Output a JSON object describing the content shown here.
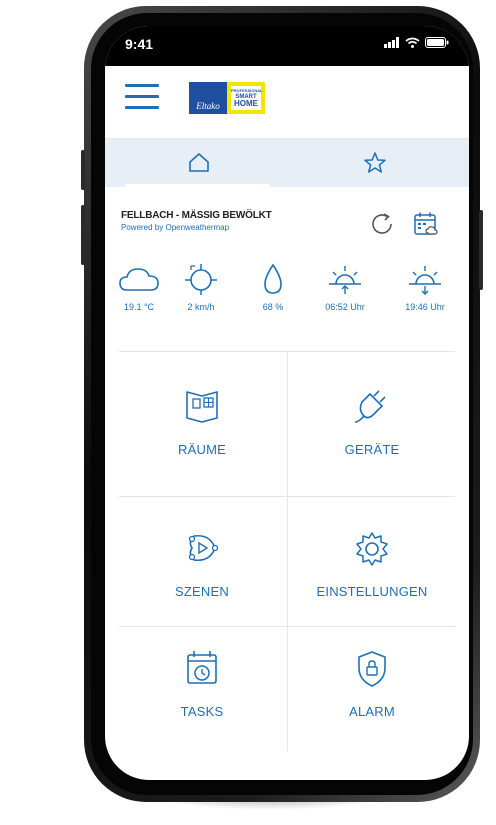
{
  "status_bar": {
    "time": "9:41"
  },
  "header": {
    "logo_text": "Eltako",
    "badge_lines": [
      "PROFESSIONAL",
      "SMART",
      "HOME"
    ]
  },
  "weather": {
    "title": "FELLBACH - MÄSSIG BEWÖLKT",
    "subtitle": "Powered by Openweathermap",
    "items": [
      {
        "icon": "cloud-icon",
        "value": "19.1 °C"
      },
      {
        "icon": "wind-compass-icon",
        "value": "2 km/h"
      },
      {
        "icon": "humidity-drop-icon",
        "value": "68 %"
      },
      {
        "icon": "sunrise-icon",
        "value": "06:52 Uhr"
      },
      {
        "icon": "sunset-icon",
        "value": "19:46 Uhr"
      }
    ]
  },
  "menu": {
    "raeume": "RÄUME",
    "geraete": "GERÄTE",
    "szenen": "SZENEN",
    "einstellungen": "EINSTELLUNGEN",
    "tasks": "TASKS",
    "alarm": "ALARM"
  },
  "colors": {
    "accent": "#1f6fb6",
    "tab_bg": "#e7eef5",
    "logo_blue": "#1f4f9f",
    "logo_yellow": "#f2e600"
  }
}
